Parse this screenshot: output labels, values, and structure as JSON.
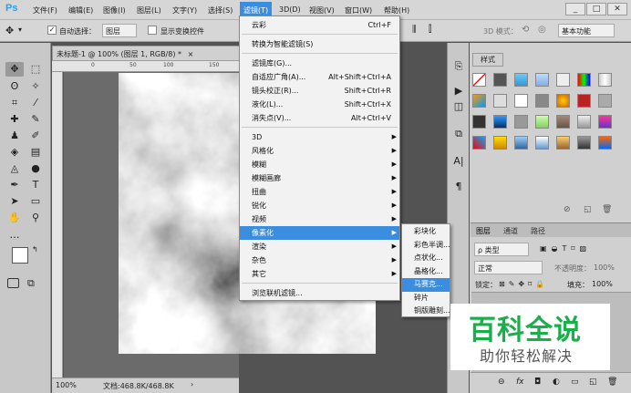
{
  "app": {
    "logo": "Ps"
  },
  "menubar": {
    "items": [
      "文件(F)",
      "编辑(E)",
      "图像(I)",
      "图层(L)",
      "文字(Y)",
      "选择(S)",
      "滤镜(T)",
      "3D(D)",
      "视图(V)",
      "窗口(W)",
      "帮助(H)"
    ],
    "active_index": 6,
    "window_buttons": [
      "_",
      "□",
      "✕"
    ]
  },
  "options": {
    "auto_select_label": "自动选择：",
    "auto_select_value": "图层",
    "show_transform_label": "显示变换控件",
    "mode_3d_label": "3D 模式：",
    "workspace": "基本功能"
  },
  "document": {
    "tab_title": "未标题-1 @ 100% (图层 1, RGB/8) *",
    "tab_close": "×",
    "ruler_top": [
      "0",
      "50",
      "100",
      "150"
    ],
    "status_zoom": "100%",
    "status_doc": "文档:468.8K/468.8K",
    "status_arrow": "›"
  },
  "filter_menu": {
    "items": [
      {
        "label": "云彩",
        "shortcut": "Ctrl+F"
      },
      {
        "separator": true
      },
      {
        "label": "转换为智能滤镜(S)"
      },
      {
        "separator": true
      },
      {
        "label": "滤镜库(G)..."
      },
      {
        "label": "自适应广角(A)...",
        "shortcut": "Alt+Shift+Ctrl+A"
      },
      {
        "label": "镜头校正(R)...",
        "shortcut": "Shift+Ctrl+R"
      },
      {
        "label": "液化(L)...",
        "shortcut": "Shift+Ctrl+X"
      },
      {
        "label": "消失点(V)...",
        "shortcut": "Alt+Ctrl+V"
      },
      {
        "separator": true
      },
      {
        "label": "3D",
        "submenu": true
      },
      {
        "label": "风格化",
        "submenu": true
      },
      {
        "label": "模糊",
        "submenu": true
      },
      {
        "label": "模糊画廊",
        "submenu": true
      },
      {
        "label": "扭曲",
        "submenu": true
      },
      {
        "label": "锐化",
        "submenu": true
      },
      {
        "label": "视频",
        "submenu": true
      },
      {
        "label": "像素化",
        "submenu": true,
        "highlighted": true
      },
      {
        "label": "渲染",
        "submenu": true
      },
      {
        "label": "杂色",
        "submenu": true
      },
      {
        "label": "其它",
        "submenu": true
      },
      {
        "separator": true
      },
      {
        "label": "浏览联机滤镜..."
      }
    ]
  },
  "pixelate_submenu": {
    "items": [
      "彩块化",
      "彩色半调...",
      "点状化...",
      "晶格化...",
      "马赛克...",
      "碎片",
      "铜版雕刻..."
    ],
    "highlighted_index": 4
  },
  "styles_panel": {
    "tab": "样式"
  },
  "layers_panel": {
    "tabs": [
      "图层",
      "通道",
      "路径"
    ],
    "filter_kind": "ρ 类型",
    "blend_mode": "正常",
    "opacity_label": "不透明度：",
    "opacity_value": "100%",
    "lock_label": "锁定：",
    "fill_label": "填充：",
    "fill_value": "100%",
    "bottom_icons": [
      "⊖",
      "fx",
      "◘",
      "◐",
      "▭",
      "◱",
      "🗑"
    ]
  },
  "watermark": {
    "title": "百科全说",
    "subtitle": "助你轻松解决"
  },
  "colors": {
    "accent": "#3b8de0",
    "watermark_green": "#1aaf4b",
    "ps_blue": "#27a0f0"
  }
}
